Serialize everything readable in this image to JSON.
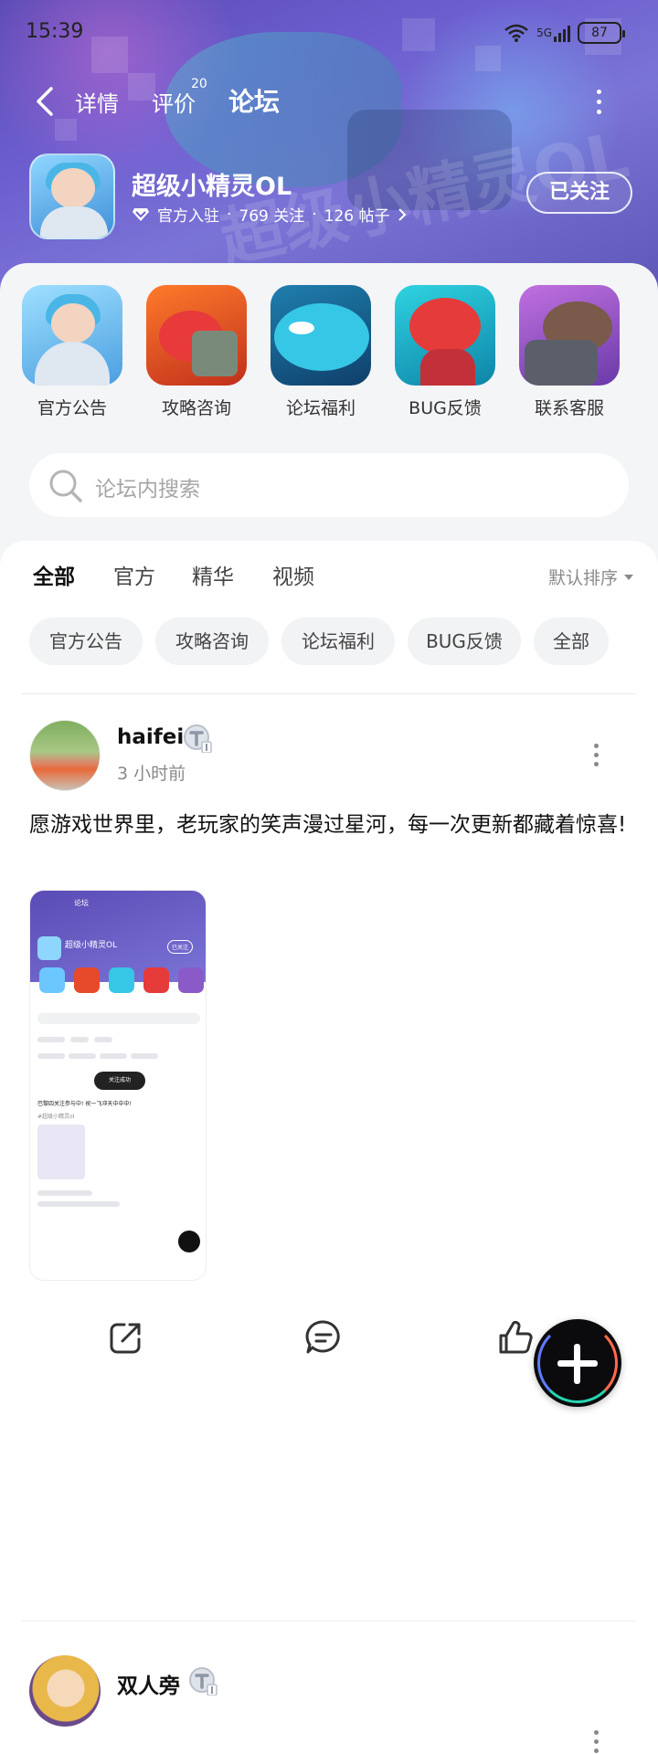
{
  "status": {
    "time": "15:39",
    "network": "5G",
    "battery": "87"
  },
  "nav": {
    "tabs": [
      {
        "label": "详情"
      },
      {
        "label": "评价",
        "badge": "20"
      },
      {
        "label": "论坛",
        "active": true
      }
    ]
  },
  "game": {
    "name": "超级小精灵OL",
    "official": "官方入驻",
    "followers": "769 关注",
    "posts": "126 帖子",
    "follow_label": "已关注",
    "watermark": "超级小精灵OL"
  },
  "shortcuts": [
    {
      "label": "官方公告"
    },
    {
      "label": "攻略咨询"
    },
    {
      "label": "论坛福利"
    },
    {
      "label": "BUG反馈"
    },
    {
      "label": "联系客服"
    }
  ],
  "search": {
    "placeholder": "论坛内搜索"
  },
  "feed": {
    "tabs": [
      {
        "label": "全部",
        "active": true
      },
      {
        "label": "官方"
      },
      {
        "label": "精华"
      },
      {
        "label": "视频"
      }
    ],
    "sort_label": "默认排序",
    "chips": [
      {
        "label": "官方公告"
      },
      {
        "label": "攻略咨询"
      },
      {
        "label": "论坛福利"
      },
      {
        "label": "BUG反馈"
      },
      {
        "label": "全部"
      }
    ]
  },
  "post": {
    "user": "haifei",
    "time": "3 小时前",
    "text": "愿游戏世界里，老玩家的笑声漫过星河，每一次更新都藏着惊喜!",
    "thumbnail": {
      "title": "超级小精灵OL",
      "follow_label": "已关注",
      "toast": "关注成功",
      "post_text": "巴黎四关注参与中! 祝一飞冲天中中中!",
      "tag": "#超级小精灵ol"
    }
  },
  "post2": {
    "user": "双人旁"
  },
  "colors": {
    "accent": "#27d6b0",
    "banner": "#6d5fd0"
  }
}
